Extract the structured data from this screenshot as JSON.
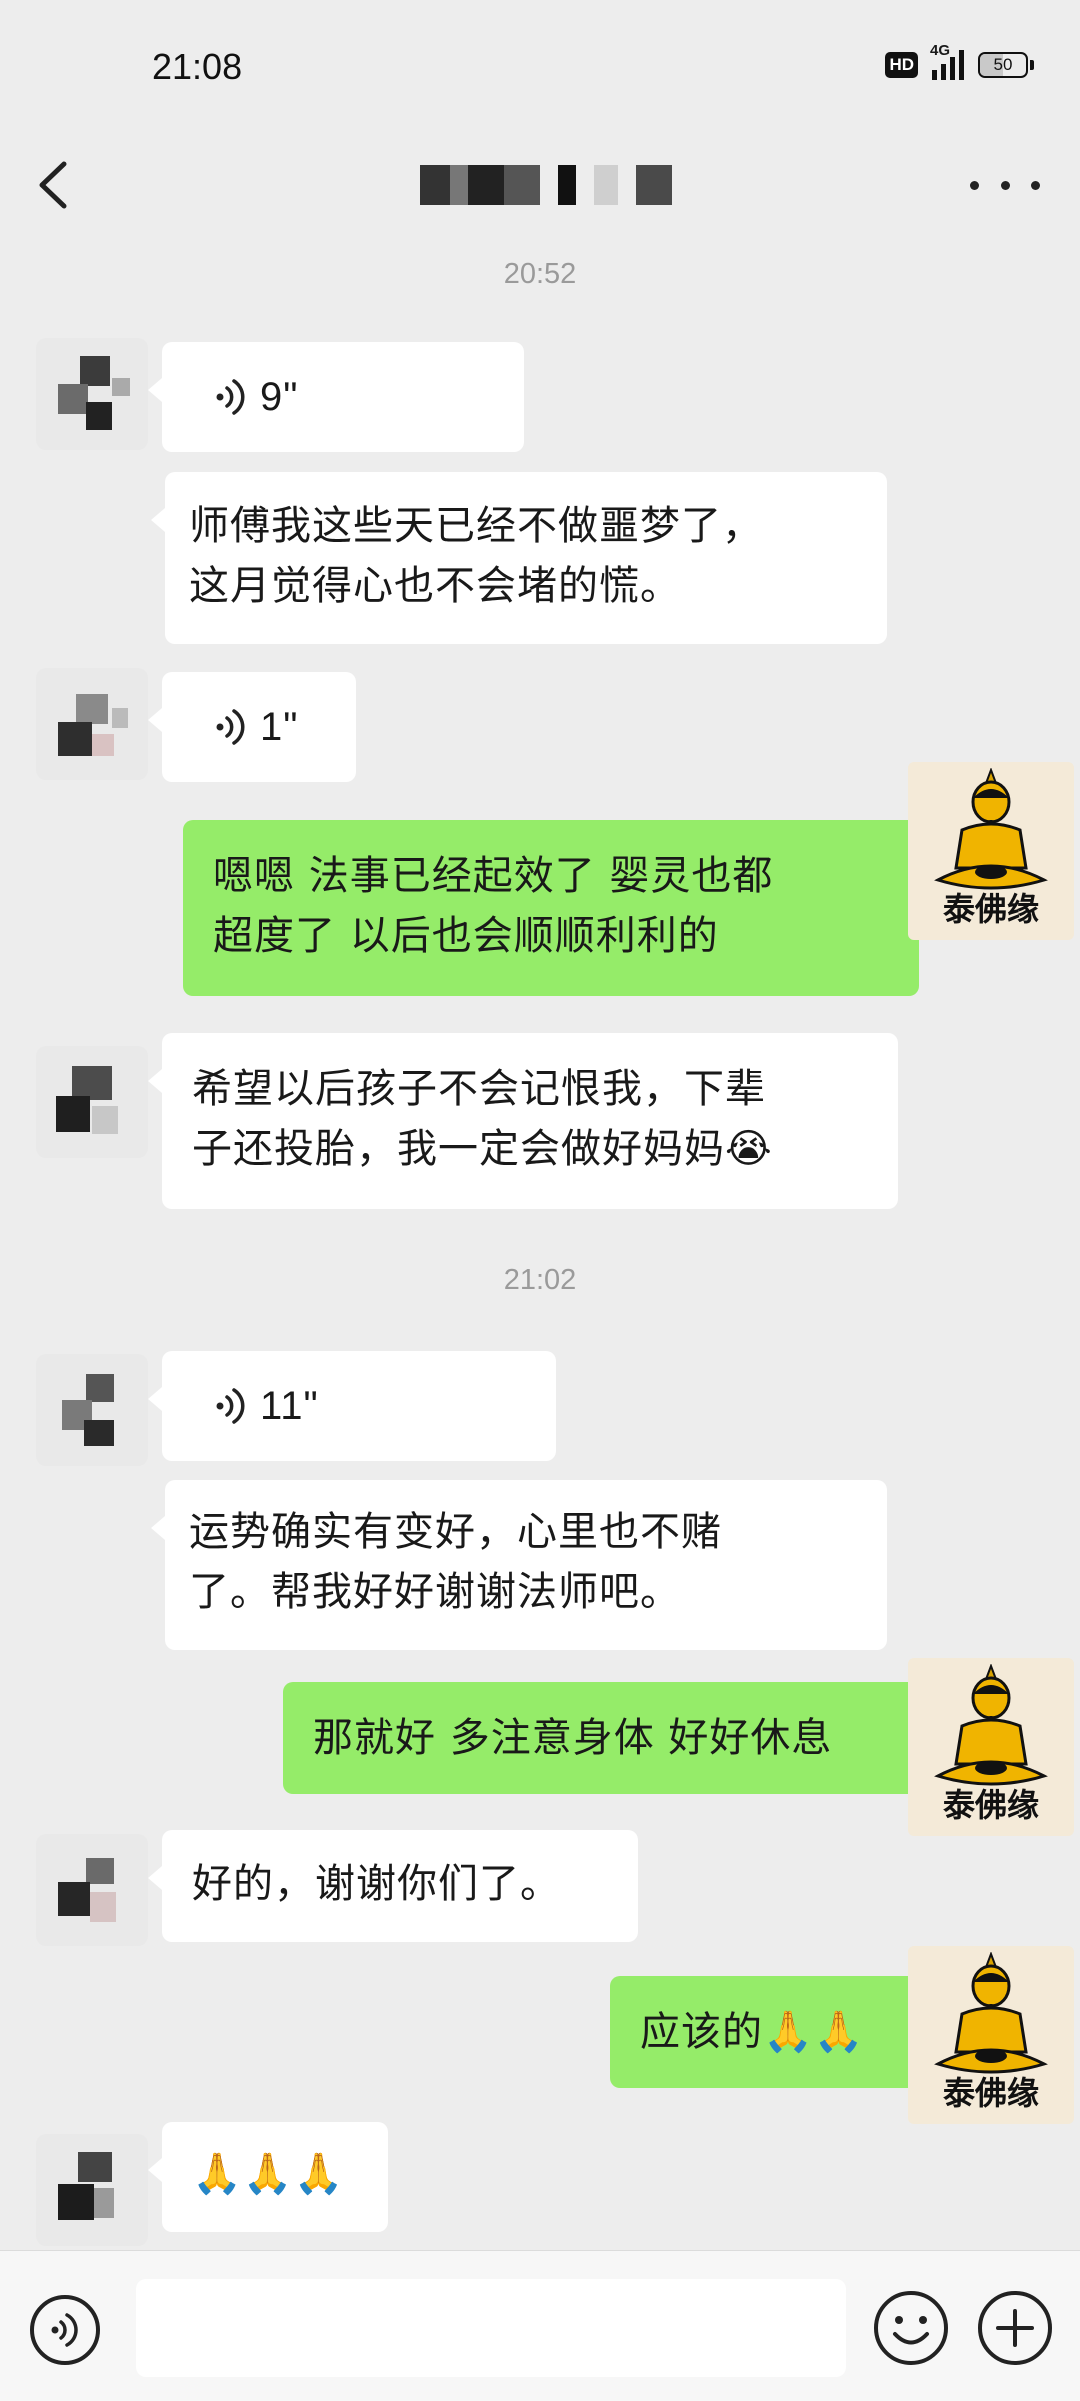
{
  "status_bar": {
    "time": "21:08",
    "hd": "HD",
    "network": "4G",
    "battery": "50",
    "battery_level": 0.5
  },
  "header": {
    "back_icon": "chevron-left-icon",
    "more_icon": "more-dots-icon"
  },
  "timestamps": [
    "20:52",
    "21:02"
  ],
  "messages": [
    {
      "side": "in",
      "type": "voice",
      "duration": "9\""
    },
    {
      "side": "in",
      "type": "text",
      "lines": [
        "师傅我这些天已经不做噩梦了，",
        "这月觉得心也不会堵的慌。"
      ]
    },
    {
      "side": "in",
      "type": "voice",
      "duration": "1\""
    },
    {
      "side": "out",
      "type": "text",
      "lines": [
        "嗯嗯 法事已经起效了 婴灵也都",
        "超度了 以后也会顺顺利利的"
      ]
    },
    {
      "side": "in",
      "type": "text",
      "lines": [
        "希望以后孩子不会记恨我，下辈",
        "子还投胎，我一定会做好妈妈😭"
      ]
    },
    {
      "side": "in",
      "type": "voice",
      "duration": "11\""
    },
    {
      "side": "in",
      "type": "text",
      "lines": [
        "运势确实有变好，心里也不赌",
        "了。帮我好好谢谢法师吧。"
      ]
    },
    {
      "side": "out",
      "type": "text",
      "lines": [
        "那就好 多注意身体 好好休息"
      ]
    },
    {
      "side": "in",
      "type": "text",
      "lines": [
        "好的，谢谢你们了。"
      ]
    },
    {
      "side": "out",
      "type": "text",
      "lines": [
        "应该的🙏🙏"
      ]
    },
    {
      "side": "in",
      "type": "text",
      "lines": [
        "🙏🙏🙏"
      ]
    }
  ],
  "my_avatar": {
    "label": "泰佛缘",
    "icon": "buddha-icon"
  },
  "input_bar": {
    "voice_icon": "voice-toggle-icon",
    "emoji_icon": "emoji-icon",
    "plus_icon": "plus-icon",
    "value": ""
  },
  "colors": {
    "background": "#ededed",
    "bubble_out": "#95ec69",
    "bubble_in": "#ffffff"
  }
}
